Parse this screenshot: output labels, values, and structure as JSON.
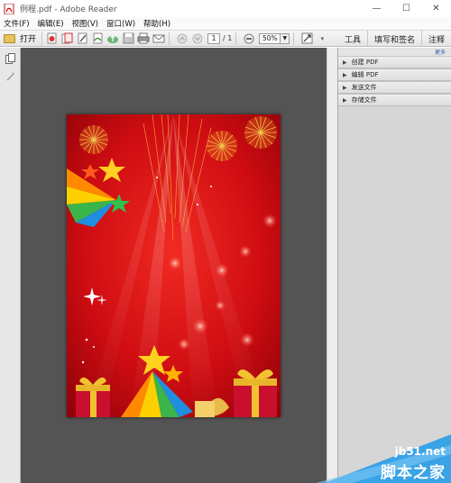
{
  "window": {
    "title": "例程.pdf - Adobe Reader",
    "controls": [
      "—",
      "☐",
      "✕"
    ]
  },
  "menu": [
    "文件(F)",
    "编辑(E)",
    "视图(V)",
    "窗口(W)",
    "帮助(H)"
  ],
  "toolbar": {
    "open_label": "打开",
    "page_current": "1",
    "page_total": "/ 1",
    "zoom": "50%",
    "right_buttons": [
      "工具",
      "填写和签名",
      "注释"
    ]
  },
  "right_pane": {
    "customize": "更多",
    "items": [
      "创建 PDF",
      "编辑 PDF",
      "发送文件",
      "存储文件"
    ]
  },
  "watermark": {
    "site": "jb51.net",
    "name": "脚本之家"
  },
  "colors": {
    "doc_bg": "#545454",
    "poster_red": "#d9121b",
    "gold": "#f2c230"
  }
}
